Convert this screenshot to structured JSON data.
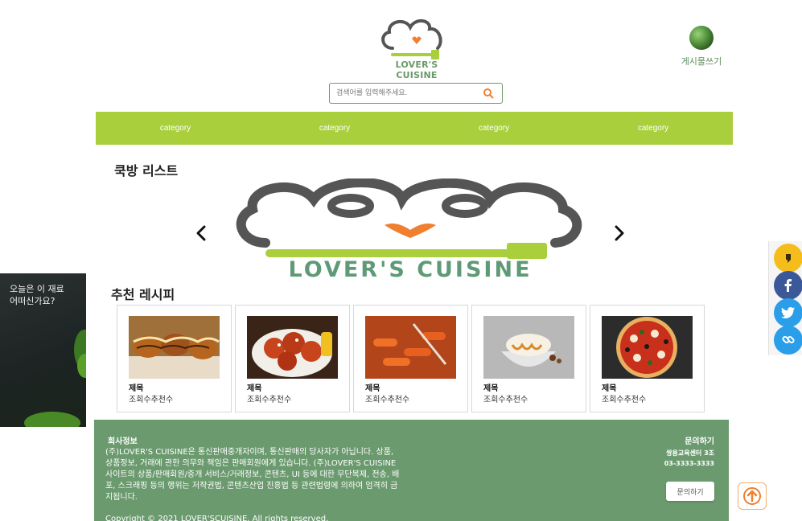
{
  "header": {
    "logo_text": "LOVER'S CUISINE",
    "write_post_label": "게시물쓰기"
  },
  "search": {
    "placeholder": "검색어를 입력해주세요."
  },
  "nav": {
    "items": [
      "category",
      "category",
      "category",
      "category"
    ]
  },
  "sections": {
    "cookbang_title": "쿡방 리스트",
    "recommend_title": "추천 레시피"
  },
  "carousel": {
    "banner_text": "LOVER'S CUISINE"
  },
  "cards": [
    {
      "title": "제목",
      "meta": "조회수추천수",
      "image": "takoyaki"
    },
    {
      "title": "제목",
      "meta": "조회수추천수",
      "image": "tangsuyuk"
    },
    {
      "title": "제목",
      "meta": "조회수추천수",
      "image": "tteokbokki"
    },
    {
      "title": "제목",
      "meta": "조회수추천수",
      "image": "dessert"
    },
    {
      "title": "제목",
      "meta": "조회수추천수",
      "image": "pizza"
    }
  ],
  "side_ad": {
    "text": "오늘은 이 재료\n어떠신가요?"
  },
  "social": {
    "icons": [
      "kakao-icon",
      "facebook-icon",
      "twitter-icon",
      "link-icon"
    ]
  },
  "footer": {
    "title": "회사정보",
    "body": "(주)LOVER'S CUISINE은 통신판매중개자이며, 통신판매의 당사자가 아닙니다. 상품, 상품정보, 거래에 관한 의무와 책임은 판매회원에게 있습니다. (주)LOVER'S CUISINE 사이트의 상품/판매회원/중개 서비스/거래정보, 콘텐츠, UI 등에 대한 무단복제, 전송, 배포, 스크래핑 등의 행위는 저작권법, 콘텐츠산업 진흥법 등 관련법령에 의하여 엄격히 금지됩니다.",
    "copyright": "Copyright © 2021 LOVER'SCUISINE. All rights reserved.",
    "contact_title": "문의하기",
    "contact_line1": "쌍용교육센터 3조",
    "contact_line2": "03-3333-3333",
    "contact_button": "문의하기"
  },
  "colors": {
    "nav_green": "#a9cf3c",
    "footer_green": "#6a9a6e",
    "logo_green": "#6a9a68",
    "accent_orange": "#f08030"
  }
}
